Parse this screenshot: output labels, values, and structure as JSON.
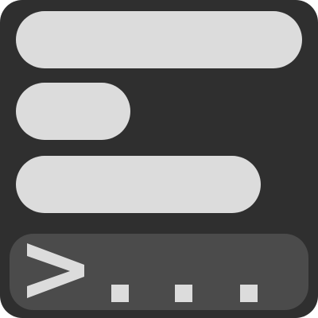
{
  "icon": {
    "name": "terminal-console-icon",
    "colors": {
      "background": "#2f2f2f",
      "bar": "#dcdcdc",
      "prompt_panel": "#4b4b4b",
      "prompt_text": "#dcdcdc"
    }
  },
  "prompt": {
    "symbol": ">",
    "ellipsis": "..."
  }
}
